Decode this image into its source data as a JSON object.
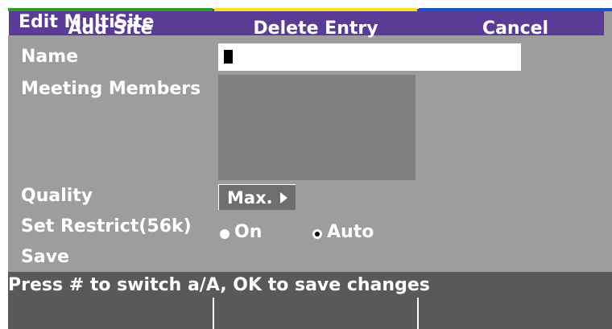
{
  "window": {
    "title": "Edit MultiSite"
  },
  "form": {
    "name_label": "Name",
    "name_value": "",
    "members_label": "Meeting Members",
    "quality_label": "Quality",
    "quality_value": "Max.",
    "restrict_label": "Set Restrict(56k)",
    "restrict_options": [
      {
        "label": "On",
        "selected": false
      },
      {
        "label": "Auto",
        "selected": true
      }
    ],
    "save_label": "Save"
  },
  "status": {
    "text": "Press # to switch a/A, OK to save changes"
  },
  "softkeys": [
    {
      "label": "Add Site",
      "color": "#2e9a2e"
    },
    {
      "label": "Delete Entry",
      "color": "#f4e21a"
    },
    {
      "label": "Cancel",
      "color": "#1e52c8"
    }
  ],
  "colors": {
    "title_bar": "#5a3c96",
    "panel": "#9d9d9d",
    "status_bar": "#595959"
  },
  "icons": {
    "quality_arrow": "triangle-right-icon"
  }
}
